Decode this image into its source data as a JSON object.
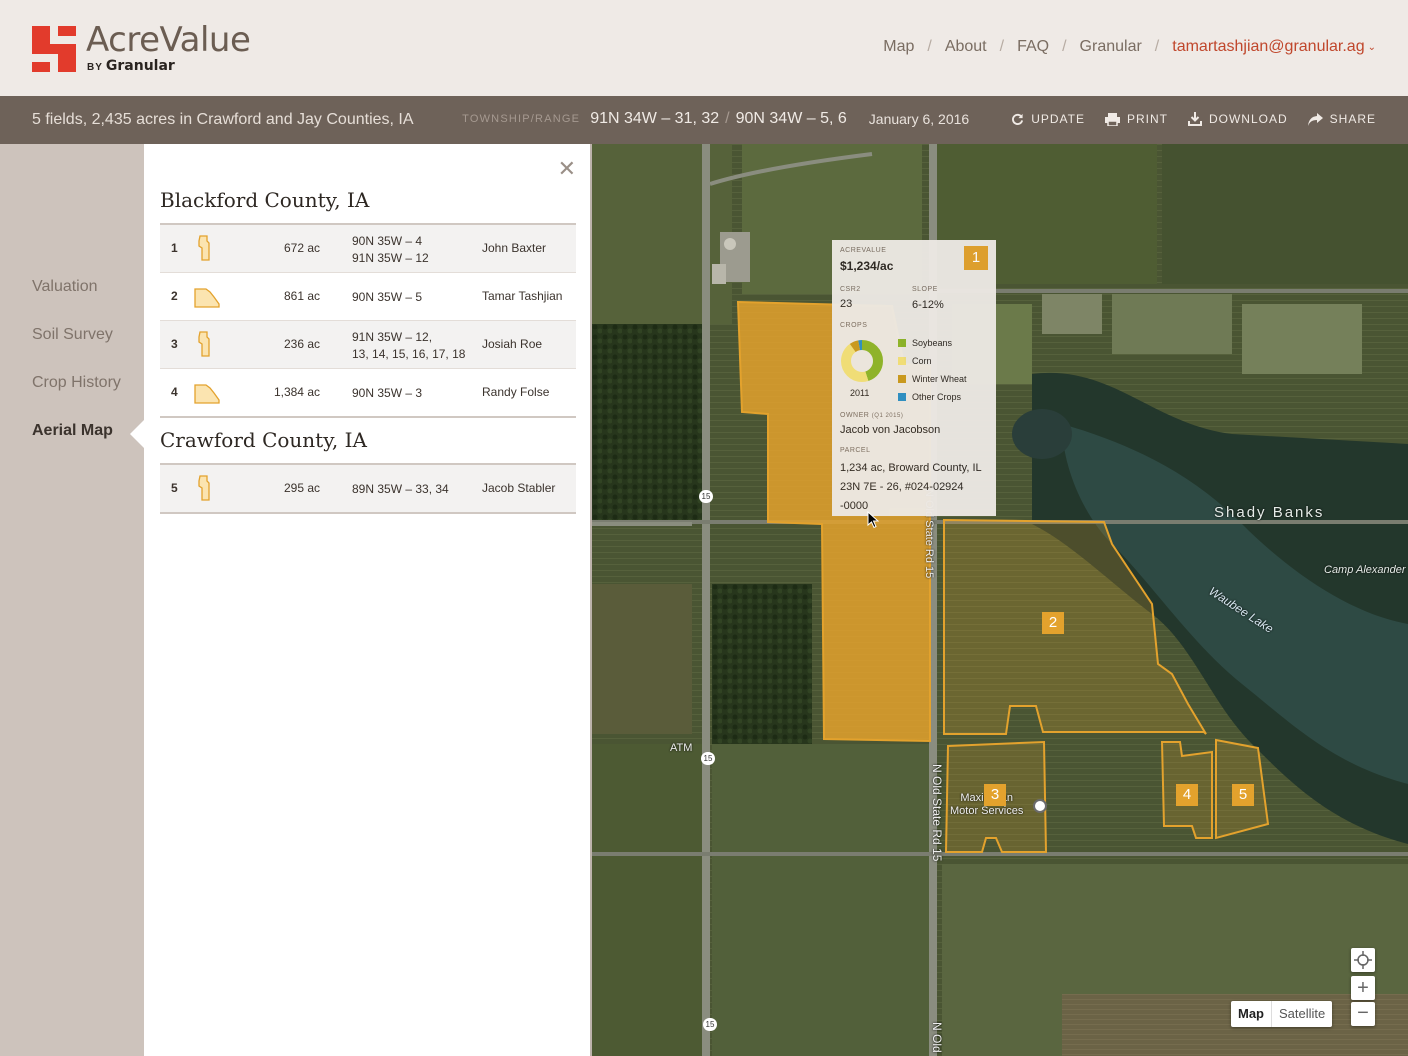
{
  "brand": {
    "name": "AcreValue",
    "by": "BY",
    "byline": "Granular"
  },
  "topnav": {
    "items": [
      "Map",
      "About",
      "FAQ",
      "Granular"
    ],
    "sep": "/",
    "user": "tamartashjian@granular.ag"
  },
  "bar": {
    "summary": "5 fields, 2,435 acres in Crawford and Jay Counties, IA",
    "tr_label": "TOWNSHIP/RANGE",
    "tr_values": [
      "91N 34W – 31, 32",
      "90N 34W – 5, 6"
    ],
    "date": "January 6, 2016",
    "actions": [
      "UPDATE",
      "PRINT",
      "DOWNLOAD",
      "SHARE"
    ]
  },
  "sidebar": {
    "items": [
      "Valuation",
      "Soil Survey",
      "Crop History",
      "Aerial Map"
    ],
    "active": "Aerial Map"
  },
  "panel": {
    "counties": [
      {
        "name": "Blackford County, IA",
        "rows": [
          {
            "num": "1",
            "acres": "672 ac",
            "trs": [
              "90N 35W – 4",
              "91N 35W – 12"
            ],
            "owner": "John Baxter"
          },
          {
            "num": "2",
            "acres": "861 ac",
            "trs": [
              "90N 35W – 5"
            ],
            "owner": "Tamar Tashjian"
          },
          {
            "num": "3",
            "acres": "236 ac",
            "trs": [
              "91N 35W – 12,",
              "13, 14, 15, 16, 17, 18"
            ],
            "owner": "Josiah Roe"
          },
          {
            "num": "4",
            "acres": "1,384 ac",
            "trs": [
              "90N 35W – 3"
            ],
            "owner": "Randy Folse"
          }
        ]
      },
      {
        "name": "Crawford County, IA",
        "rows": [
          {
            "num": "5",
            "acres": "295 ac",
            "trs": [
              "89N 35W – 33, 34"
            ],
            "owner": "Jacob Stabler"
          }
        ]
      }
    ]
  },
  "tooltip": {
    "acrevalue_label": "ACREVALUE",
    "acrevalue": "$1,234/ac",
    "badge": "1",
    "csr2_label": "CSR2",
    "csr2": "23",
    "slope_label": "SLOPE",
    "slope": "6-12%",
    "crops_label": "CROPS",
    "year": "2011",
    "crops": [
      {
        "name": "Soybeans",
        "color": "#8db52a",
        "share": 0.45
      },
      {
        "name": "Corn",
        "color": "#f2e07a",
        "share": 0.45
      },
      {
        "name": "Winter Wheat",
        "color": "#c99a1e",
        "share": 0.07
      },
      {
        "name": "Other Crops",
        "color": "#2a8fc6",
        "share": 0.03
      }
    ],
    "owner_label": "OWNER",
    "owner_sub": "(Q1 2015)",
    "owner": "Jacob von Jacobson",
    "parcel_label": "PARCEL",
    "parcel": [
      "1,234 ac,  Broward County, IL",
      "23N 7E - 26, #024-02924",
      "-0000"
    ]
  },
  "map": {
    "field_color": "#e3a22d",
    "markers": [
      "2",
      "3",
      "4",
      "5"
    ],
    "labels": {
      "shady": "Shady Banks",
      "camp": "Camp Alexander",
      "lake": "Waubee Lake",
      "road1": "N Old State Rd 15",
      "road2": "N Old State Rd 15",
      "road_bottom": "N Old",
      "atm": "ATM",
      "business": [
        "Maximican",
        "Motor Services"
      ],
      "shields": [
        "15",
        "15",
        "15"
      ]
    },
    "types": [
      "Map",
      "Satellite"
    ]
  }
}
